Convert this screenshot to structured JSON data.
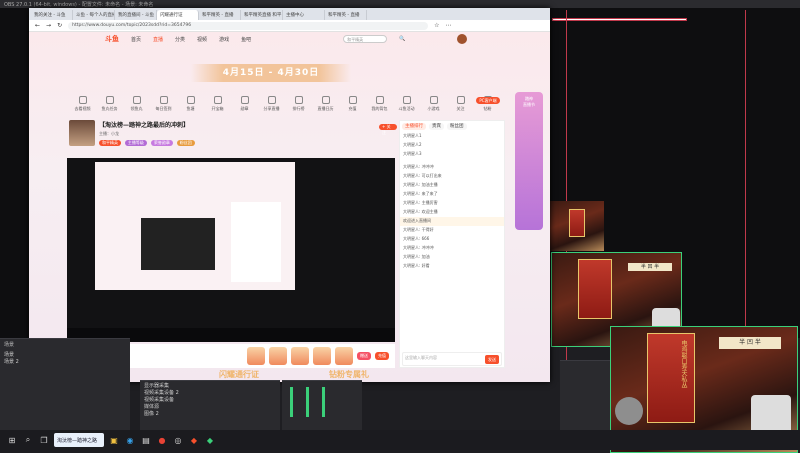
{
  "obs": {
    "title": "OBS 27.0.1 (64-bit, windows) - 配置文件: 未命名 - 场景: 未命名",
    "scene_panel_title": "场景",
    "source_panel_rows": [
      "显示器采集",
      "视频采集设备 2",
      "视频采集设备",
      "媒体源",
      "图像 2"
    ],
    "scene_rows": [
      "场景",
      "场景 2"
    ]
  },
  "browser": {
    "tabs": [
      "我的关注 - 斗鱼",
      "斗鱼 - 每个人的直播平台",
      "我的直播间 - 斗鱼",
      "闪耀通行证",
      "和平精英 - 直播",
      "和平精英直播 和平",
      "主播中心",
      "和平精英 - 直播"
    ],
    "active_tab_index": 3,
    "url": "https://www.douyu.com/topic/2023sdd?rid=3654796"
  },
  "site": {
    "logo": "斗鱼",
    "nav": [
      "首页",
      "直播",
      "分类",
      "视频",
      "游戏",
      "鱼吧"
    ],
    "nav_active": "直播",
    "search_placeholder": "和平精英",
    "ribbon": "4月15日 - 4月30日",
    "icons": [
      "去看视频",
      "鱼丸任务",
      "领鱼丸",
      "每日签到",
      "鱼塘",
      "开宝箱",
      "勋章",
      "分享直播",
      "排行榜",
      "直播日历",
      "充值",
      "我的背包",
      "斗鱼活动",
      "小游戏",
      "关注",
      "钻粉",
      "更多"
    ],
    "pc_button": "PC客户端",
    "room_title": "【淘汰榜—踏神之路最后的冲刺】",
    "streamer_name": "主播：小龙",
    "follow_button": "+ 关注",
    "pills": [
      "和平精英",
      "主播等级",
      "荣誉勋章",
      "粉丝团"
    ],
    "bottom_left_banner": "闪耀通行证",
    "bottom_right_banner": "钻粉专属礼",
    "gift_send": "赠送",
    "gift_recharge": "充值"
  },
  "chat": {
    "tabs": [
      "主播排行",
      "贵宾",
      "粉丝团"
    ],
    "active_tab": "主播排行",
    "ranking": [
      "大明星人1",
      "大明星人2",
      "大明星人3"
    ],
    "messages": [
      [
        "弹幕",
        "大明星人: 冲冲冲"
      ],
      [
        "弹幕",
        "大明星人: 可以打出来"
      ],
      [
        "弹幕",
        "大明星人: 加油主播"
      ],
      [
        "弹幕",
        "大明星人: 来了来了"
      ],
      [
        "弹幕",
        "大明星人: 主播厉害"
      ],
      [
        "弹幕",
        "大明星人: 欢迎主播"
      ],
      [
        "欢迎",
        "欢迎进入直播间"
      ],
      [
        "弹幕",
        "大明星人: 干得好"
      ],
      [
        "弹幕",
        "大明星人: 666"
      ],
      [
        "弹幕",
        "大明星人: 冲冲冲"
      ],
      [
        "弹幕",
        "大明星人: 加油"
      ],
      [
        "弹幕",
        "大明星人: 好看"
      ]
    ],
    "input_placeholder": "这里输入聊天内容",
    "send_label": "发送"
  },
  "side_ad": {
    "line1": "踏神",
    "line2": "直播节"
  },
  "taskbar": {
    "active_label": "淘汰榜—踏神之路"
  },
  "colors": {
    "accent": "#f7502c",
    "obs_bg": "#0e0e10"
  }
}
